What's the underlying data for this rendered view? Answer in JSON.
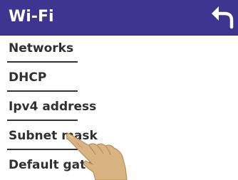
{
  "header": {
    "title": "Wi-Fi",
    "back_icon": "back-arrow-icon"
  },
  "menu": {
    "items": [
      {
        "label": "Networks"
      },
      {
        "label": "DHCP"
      },
      {
        "label": "Ipv4 address"
      },
      {
        "label": "Subnet mask"
      },
      {
        "label": "Default gateway"
      }
    ]
  },
  "overlay": {
    "icon": "pointing-hand-icon"
  },
  "colors": {
    "header_bg": "#3d3590",
    "header_text": "#ffffff",
    "item_text": "#303030",
    "divider": "#333333",
    "hand_skin": "#d9b482"
  }
}
